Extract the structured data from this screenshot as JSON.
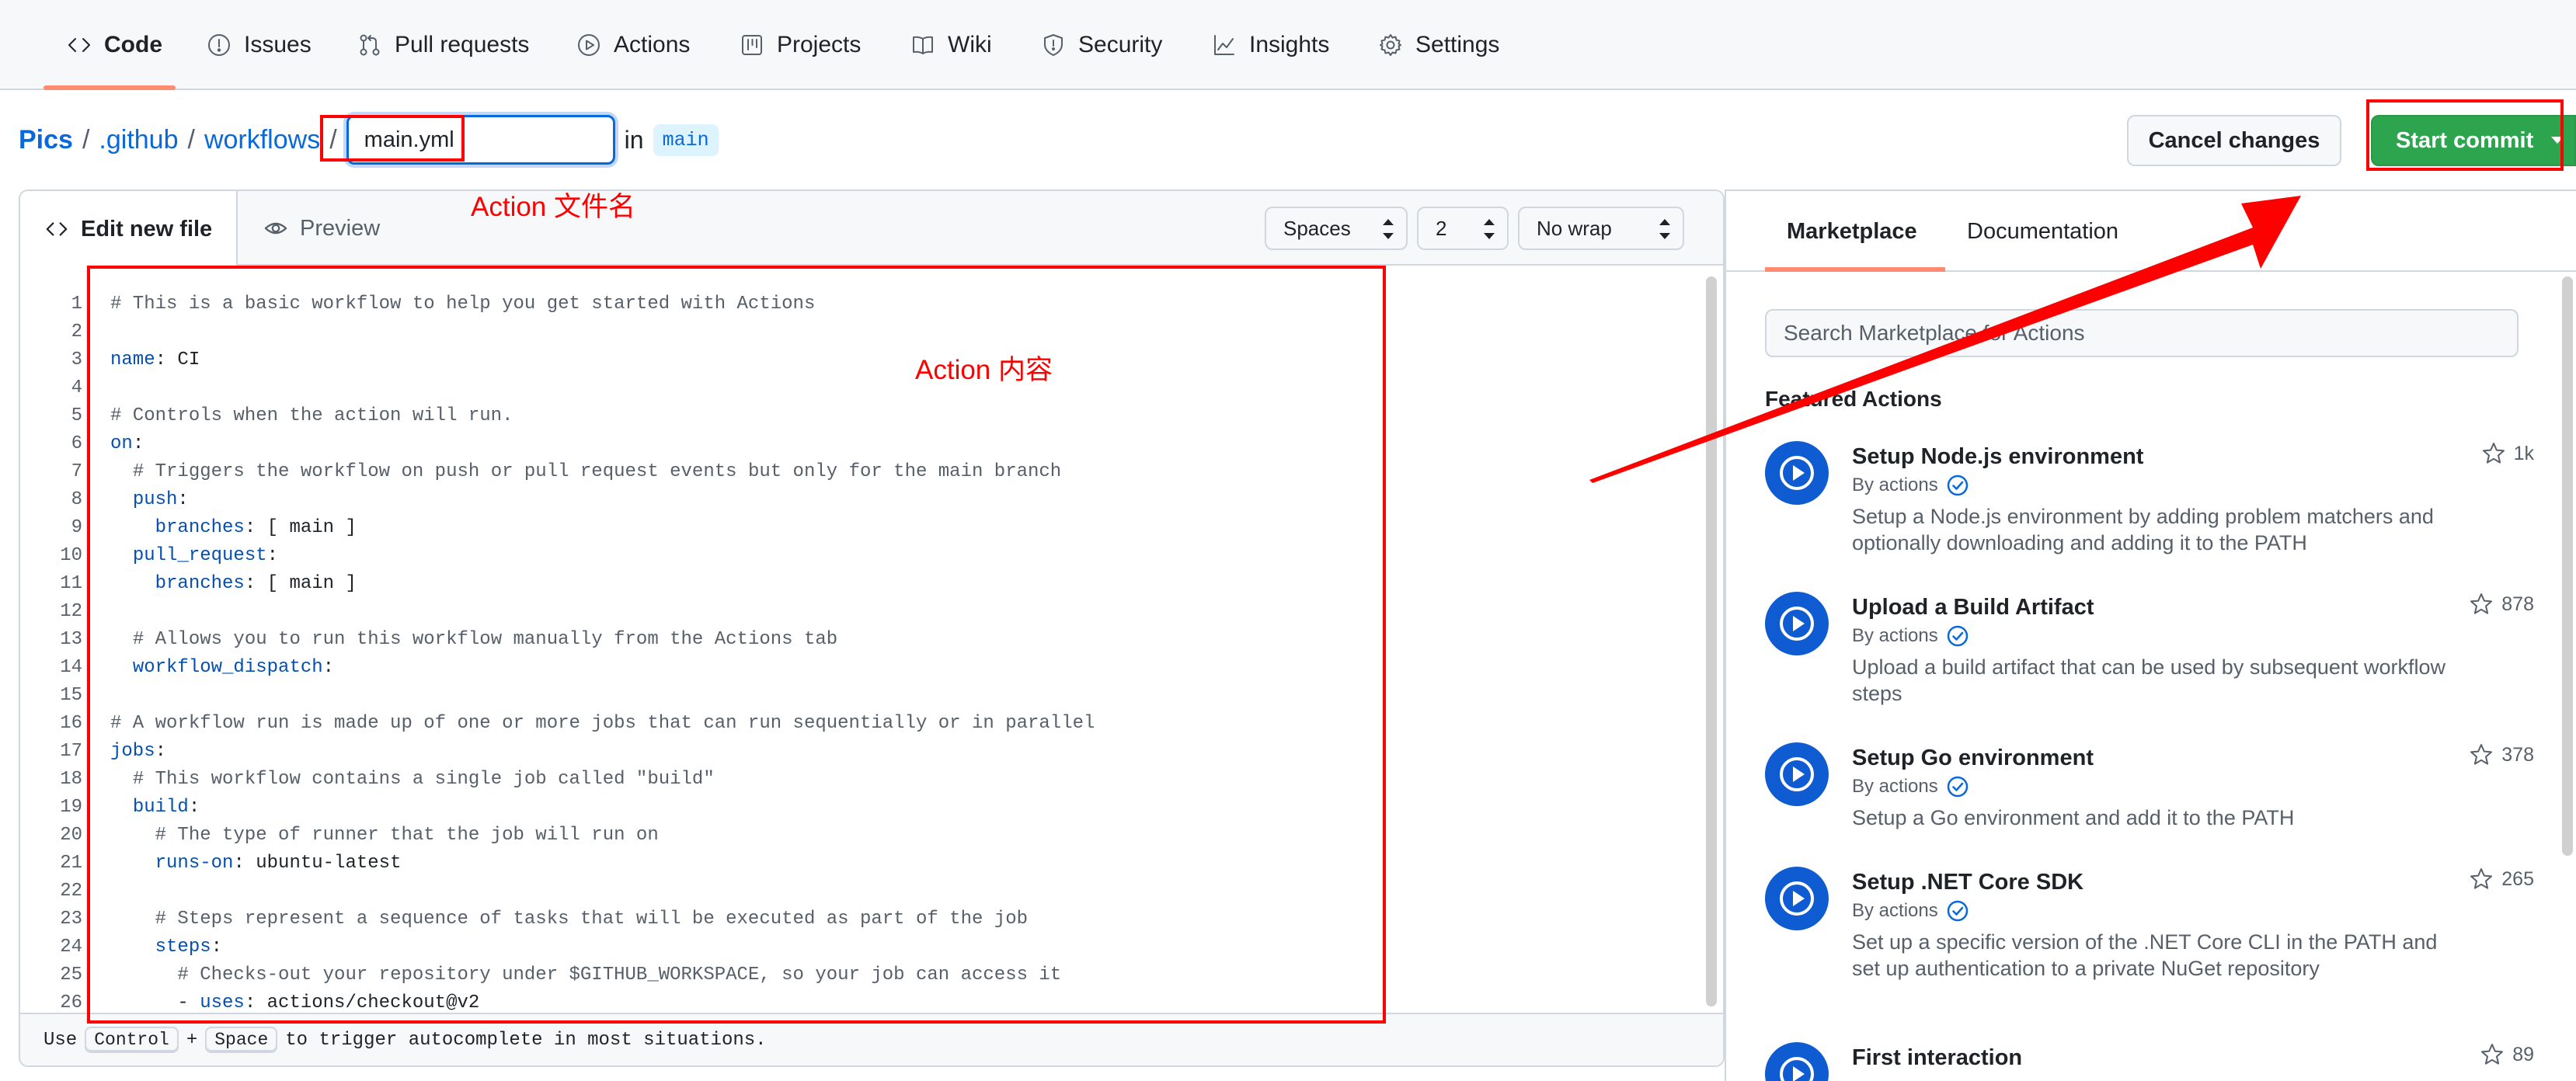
{
  "nav": {
    "tabs": [
      {
        "label": "Code"
      },
      {
        "label": "Issues"
      },
      {
        "label": "Pull requests"
      },
      {
        "label": "Actions"
      },
      {
        "label": "Projects"
      },
      {
        "label": "Wiki"
      },
      {
        "label": "Security"
      },
      {
        "label": "Insights"
      },
      {
        "label": "Settings"
      }
    ],
    "active": "Code"
  },
  "breadcrumb": {
    "owner": "Pics",
    "dir1": ".github",
    "dir2": "workflows",
    "separator": "/",
    "filename": "main.yml",
    "in_text": "in",
    "branch": "main"
  },
  "buttons": {
    "cancel": "Cancel changes",
    "commit": "Start commit"
  },
  "editor": {
    "edit_tab": "Edit new file",
    "preview_tab": "Preview",
    "indent_mode": "Spaces",
    "indent_size": "2",
    "wrap_mode": "No wrap",
    "line_numbers": [
      "1",
      "2",
      "3",
      "4",
      "5",
      "6",
      "7",
      "8",
      "9",
      "10",
      "11",
      "12",
      "13",
      "14",
      "15",
      "16",
      "17",
      "18",
      "19",
      "20",
      "21",
      "22",
      "23",
      "24",
      "25",
      "26"
    ],
    "lines": [
      {
        "cmt": "# This is a basic workflow to help you get started with Actions"
      },
      {},
      {
        "key": "name",
        "rest": ": CI"
      },
      {},
      {
        "cmt": "# Controls when the action will run."
      },
      {
        "key": "on",
        "rest": ":"
      },
      {
        "indent": "  ",
        "cmt": "# Triggers the workflow on push or pull request events but only for the main branch"
      },
      {
        "indent": "  ",
        "key": "push",
        "rest": ":"
      },
      {
        "indent": "    ",
        "key": "branches",
        "rest": ": [ main ]"
      },
      {
        "indent": "  ",
        "key": "pull_request",
        "rest": ":"
      },
      {
        "indent": "    ",
        "key": "branches",
        "rest": ": [ main ]"
      },
      {},
      {
        "indent": "  ",
        "cmt": "# Allows you to run this workflow manually from the Actions tab"
      },
      {
        "indent": "  ",
        "key": "workflow_dispatch",
        "rest": ":"
      },
      {},
      {
        "cmt": "# A workflow run is made up of one or more jobs that can run sequentially or in parallel"
      },
      {
        "key": "jobs",
        "rest": ":"
      },
      {
        "indent": "  ",
        "cmt": "# This workflow contains a single job called \"build\""
      },
      {
        "indent": "  ",
        "key": "build",
        "rest": ":"
      },
      {
        "indent": "    ",
        "cmt": "# The type of runner that the job will run on"
      },
      {
        "indent": "    ",
        "key": "runs-on",
        "rest": ": ubuntu-latest"
      },
      {},
      {
        "indent": "    ",
        "cmt": "# Steps represent a sequence of tasks that will be executed as part of the job"
      },
      {
        "indent": "    ",
        "key": "steps",
        "rest": ":"
      },
      {
        "indent": "      ",
        "cmt": "# Checks-out your repository under $GITHUB_WORKSPACE, so your job can access it"
      },
      {
        "indent": "      - ",
        "key": "uses",
        "rest": ": actions/checkout@v2"
      }
    ],
    "footer": {
      "use": "Use",
      "key1": "Control",
      "plus": "+",
      "key2": "Space",
      "tail": "to trigger autocomplete in most situations."
    }
  },
  "marketplace": {
    "tab_market": "Marketplace",
    "tab_docs": "Documentation",
    "search_placeholder": "Search Marketplace for Actions",
    "featured_title": "Featured Actions",
    "actions": [
      {
        "name": "Setup Node.js environment",
        "by": "By actions",
        "desc": "Setup a Node.js environment by adding problem matchers and optionally downloading and adding it to the PATH",
        "stars": "1k"
      },
      {
        "name": "Upload a Build Artifact",
        "by": "By actions",
        "desc": "Upload a build artifact that can be used by subsequent workflow steps",
        "stars": "878"
      },
      {
        "name": "Setup Go environment",
        "by": "By actions",
        "desc": "Setup a Go environment and add it to the PATH",
        "stars": "378"
      },
      {
        "name": "Setup .NET Core SDK",
        "by": "By actions",
        "desc": "Set up a specific version of the .NET Core CLI in the PATH and set up authentication to a private NuGet repository",
        "stars": "265"
      },
      {
        "name": "First interaction",
        "by": "",
        "desc": "",
        "stars": "89"
      }
    ]
  },
  "annotations": {
    "filename_label": "Action 文件名",
    "content_label": "Action 内容",
    "color": "#ff0000"
  },
  "colors": {
    "link": "#0969da",
    "commit_green": "#2da44e",
    "active_underline": "#fd8c73",
    "action_avatar": "#0f5bd1"
  }
}
